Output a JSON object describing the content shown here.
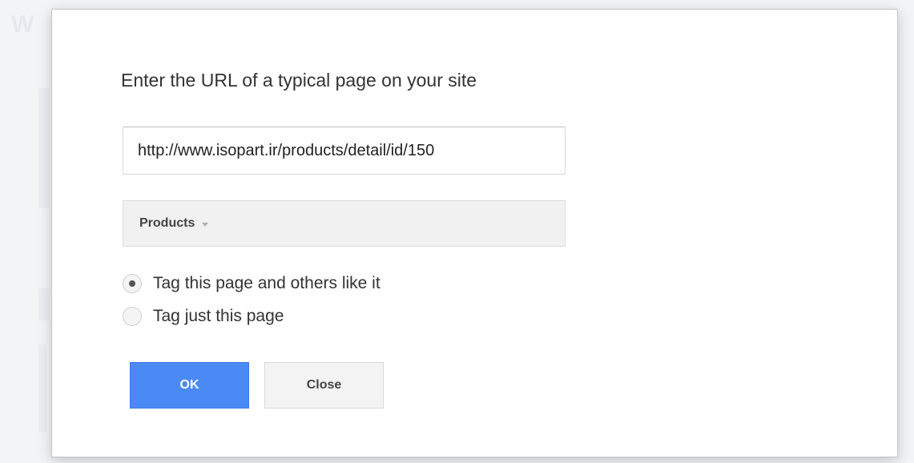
{
  "background": {
    "partial_text": "W"
  },
  "dialog": {
    "title": "Enter the URL of a typical page on your site",
    "url_input": {
      "value": "http://www.isopart.ir/products/detail/id/150"
    },
    "dropdown": {
      "selected": "Products",
      "icon": "dropdown-arrow-icon"
    },
    "radio_options": [
      {
        "label": "Tag this page and others like it",
        "selected": true
      },
      {
        "label": "Tag just this page",
        "selected": false
      }
    ],
    "buttons": {
      "ok_label": "OK",
      "close_label": "Close"
    }
  },
  "colors": {
    "primary_button": "#4a8af4",
    "secondary_button": "#f3f3f3",
    "dropdown_bg": "#f1f1f1"
  }
}
